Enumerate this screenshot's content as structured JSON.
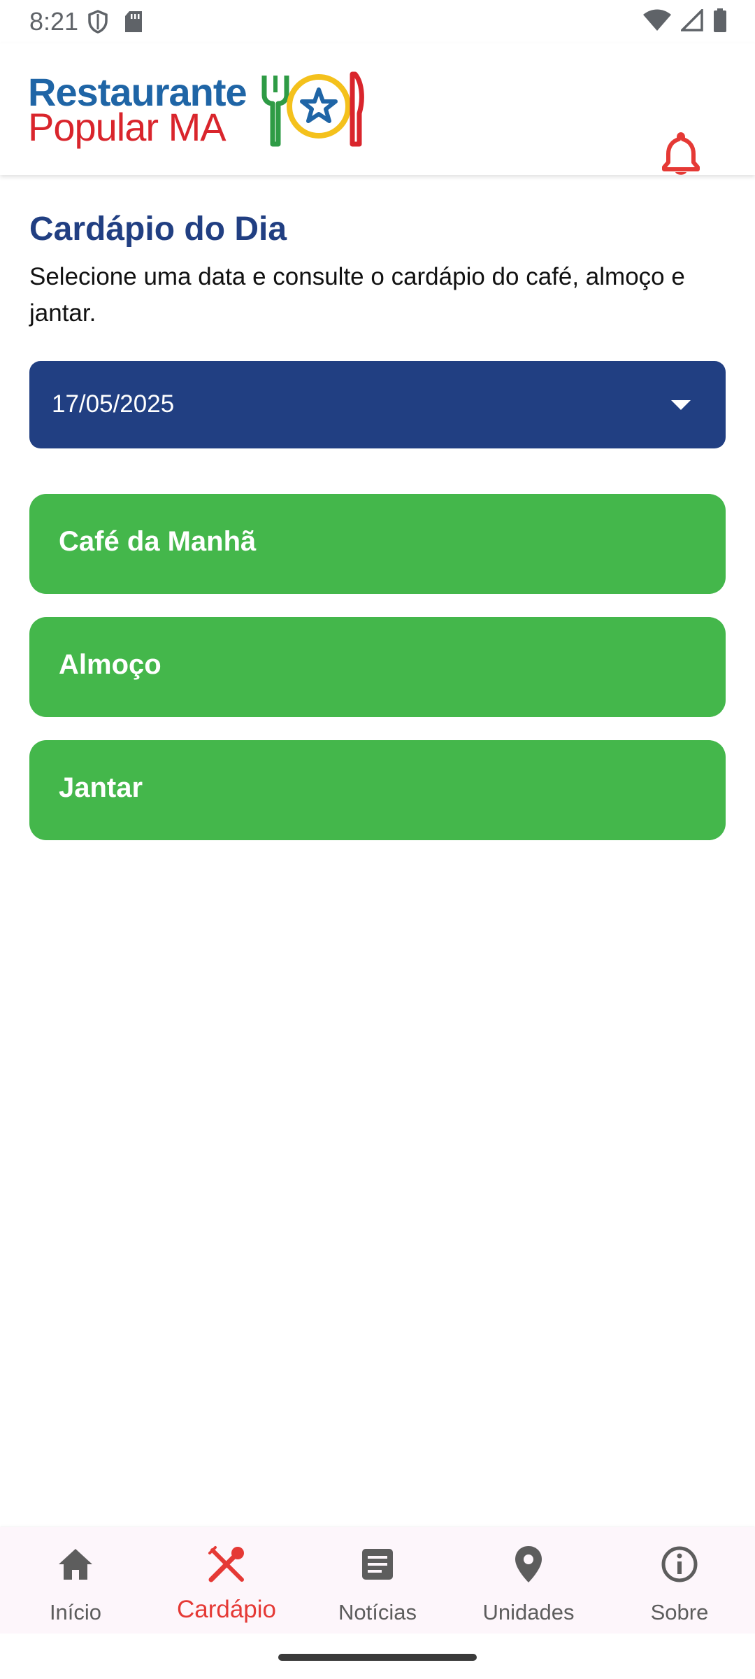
{
  "status_bar": {
    "time": "8:21"
  },
  "header": {
    "logo_line1": "Restaurante",
    "logo_line2": "Popular MA"
  },
  "main": {
    "title": "Cardápio do Dia",
    "subtitle": "Selecione uma data e consulte o cardápio do café, almoço e jantar.",
    "date_select": {
      "value": "17/05/2025"
    },
    "meals": [
      {
        "label": "Café da Manhã"
      },
      {
        "label": "Almoço"
      },
      {
        "label": "Jantar"
      }
    ]
  },
  "bottom_nav": {
    "items": [
      {
        "label": "Início",
        "icon": "home-icon"
      },
      {
        "label": "Cardápio",
        "icon": "utensils-icon",
        "active": true
      },
      {
        "label": "Notícias",
        "icon": "article-icon"
      },
      {
        "label": "Unidades",
        "icon": "location-pin-icon"
      },
      {
        "label": "Sobre",
        "icon": "info-icon"
      }
    ]
  },
  "colors": {
    "primary_blue": "#213f82",
    "meal_green": "#44b74b",
    "accent_red": "#e53935",
    "logo_blue": "#1f65a6",
    "logo_red": "#d9252c"
  }
}
